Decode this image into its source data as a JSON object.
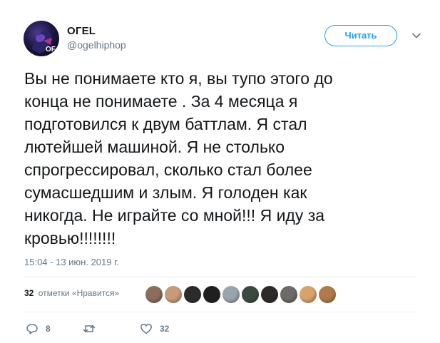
{
  "user": {
    "display_name": "OГEL",
    "handle": "@ogelhiphop"
  },
  "follow_button": {
    "label": "Читать"
  },
  "tweet": {
    "text": "Вы не понимаете кто я, вы тупо этого до\nконца не понимаете . За 4 месяца я\nподготовился к двум баттлам. Я стал\nлютейшей машиной. Я не столько\nспрогрессировал, сколько стал более\nсумасшедшим и злым. Я голоден как\nникогда. Не играйте со мной!!! Я иду за\nкровью!!!!!!!!",
    "timestamp": "15:04 - 13 июн. 2019 г."
  },
  "likes": {
    "count": "32",
    "label": "отметки «Нравится»",
    "avatar_colors": [
      "#8a6d5c",
      "#c79a7a",
      "#2b2b2b",
      "#1f1f1f",
      "#9aa4ad",
      "#3b4a3f",
      "#2f2a2a",
      "#6e6a66",
      "#d6a36a",
      "#b07a4a"
    ]
  },
  "actions": {
    "reply_count": "8",
    "retweet_count": "",
    "like_count": "32",
    "reply_icon": "reply-icon",
    "retweet_icon": "retweet-icon",
    "like_icon": "heart-icon"
  },
  "colors": {
    "accent": "#1da1f2",
    "secondary_text": "#657786",
    "primary_text": "#14171a",
    "divider": "#e6ecf0"
  }
}
